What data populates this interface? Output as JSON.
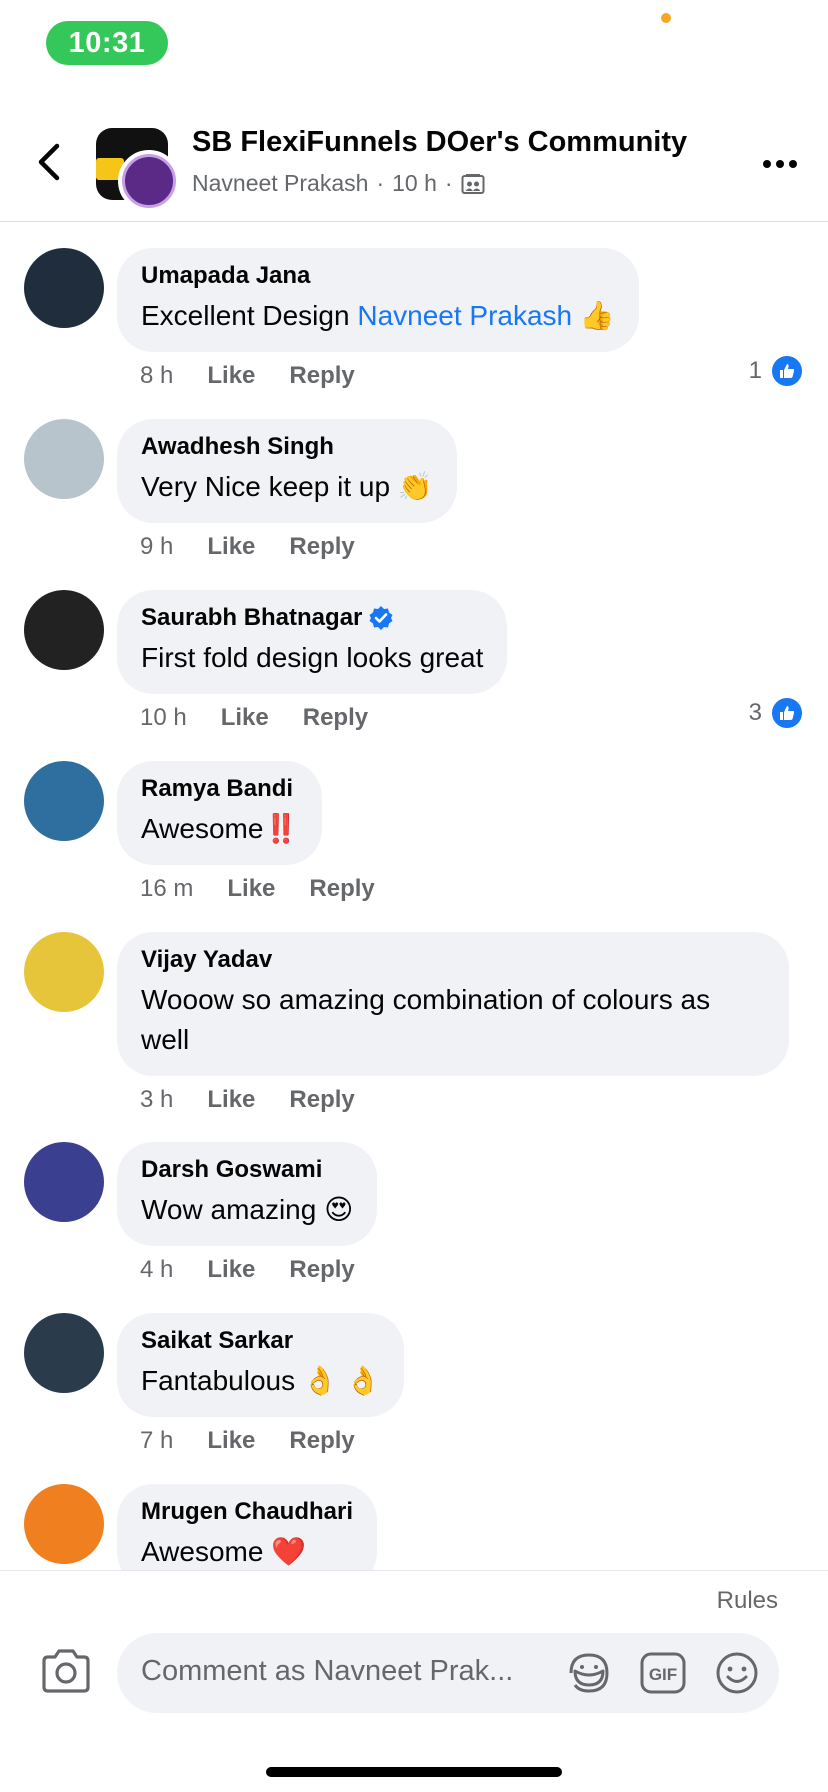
{
  "status_bar": {
    "time": "10:31"
  },
  "header": {
    "group_name": "SB FlexiFunnels DOer's Community",
    "poster_name": "Navneet Prakash",
    "time": "10 h",
    "separator": "·",
    "back_icon": "chevron-left-icon",
    "more_icon": "more-horizontal-icon",
    "audience_icon": "group-members-icon"
  },
  "actions": {
    "like": "Like",
    "reply": "Reply"
  },
  "comments": [
    {
      "name": "Umapada Jana",
      "text": "Excellent Design ",
      "mention": "Navneet Prakash",
      "emoji": "👍",
      "time": "8 h",
      "likes": "1",
      "verified": false,
      "avatar_color": "#1f2d3d"
    },
    {
      "name": "Awadhesh Singh",
      "text": "Very Nice  keep it up ",
      "emoji": "👏",
      "time": "9 h",
      "likes": "",
      "verified": false,
      "avatar_color": "#b8c4cc"
    },
    {
      "name": "Saurabh Bhatnagar",
      "text": "First fold design looks great",
      "emoji": "",
      "time": "10 h",
      "likes": "3",
      "verified": true,
      "avatar_color": "#222222"
    },
    {
      "name": "Ramya Bandi",
      "text": "Awesome",
      "emoji": "‼️",
      "time": "16 m",
      "likes": "",
      "verified": false,
      "avatar_color": "#2f6f9f"
    },
    {
      "name": "Vijay Yadav",
      "text": "Wooow so amazing combination of colours as well",
      "emoji": "",
      "time": "3 h",
      "likes": "",
      "verified": false,
      "avatar_color": "#e6c53a"
    },
    {
      "name": "Darsh Goswami",
      "text": "Wow amazing ",
      "emoji": "😍",
      "time": "4 h",
      "likes": "",
      "verified": false,
      "avatar_color": "#3a3f8f"
    },
    {
      "name": "Saikat Sarkar",
      "text": "Fantabulous ",
      "emoji": "👌 👌",
      "time": "7 h",
      "likes": "",
      "verified": false,
      "avatar_color": "#2a3b4c"
    },
    {
      "name": "Mrugen Chaudhari",
      "text": "Awesome ",
      "emoji": "❤️",
      "time": "",
      "likes": "",
      "verified": false,
      "avatar_color": "#f07f1f"
    }
  ],
  "composer": {
    "rules": "Rules",
    "placeholder": "Comment as Navneet Prak...",
    "camera_icon": "camera-icon",
    "sticker_icon": "sticker-icon",
    "gif_icon": "gif-icon",
    "emoji_icon": "emoji-icon"
  },
  "colors": {
    "accent": "#1877f2",
    "status_green": "#34c759",
    "bubble": "#f0f2f5",
    "meta": "#65676b"
  }
}
